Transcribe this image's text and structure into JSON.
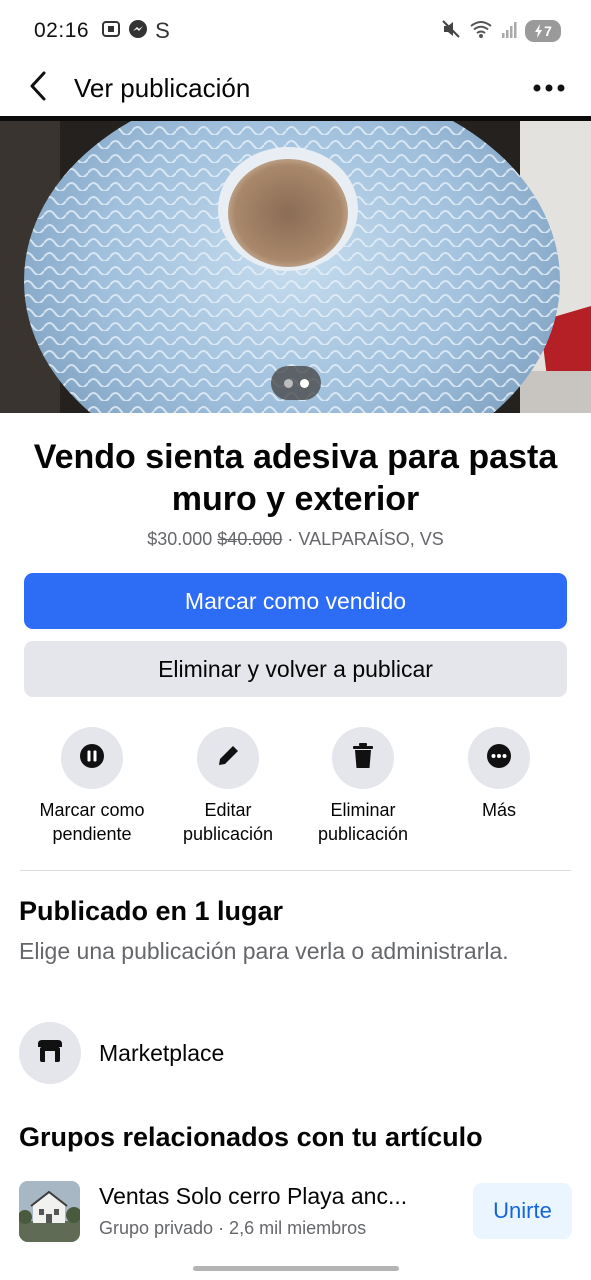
{
  "status_bar": {
    "time": "02:16",
    "left_icons": [
      "screenshot-icon",
      "messenger-icon",
      "s-app-icon"
    ],
    "s_app_glyph": "S",
    "right_icons": [
      "mute-icon",
      "wifi-icon",
      "signal-icon",
      "battery-icon"
    ],
    "battery_level": "7"
  },
  "header": {
    "title": "Ver publicación",
    "back_icon": "chevron-left-icon",
    "menu_icon": "more-horizontal-icon"
  },
  "photo": {
    "pages": 2,
    "active_page": 2
  },
  "listing": {
    "title": "Vendo sienta adesiva para pasta muro y exterior",
    "price": "$30.000",
    "old_price": "$40.000",
    "separator": "·",
    "location": "VALPARAÍSO, VS"
  },
  "buttons": {
    "mark_sold": "Marcar como vendido",
    "delete_repost": "Eliminar y volver a publicar"
  },
  "actions": [
    {
      "icon": "pause-icon",
      "label_line1": "Marcar como",
      "label_line2": "pendiente"
    },
    {
      "icon": "pencil-icon",
      "label_line1": "Editar",
      "label_line2": "publicación"
    },
    {
      "icon": "trash-icon",
      "label_line1": "Eliminar",
      "label_line2": "publicación"
    },
    {
      "icon": "more-icon",
      "label_line1": "Más",
      "label_line2": ""
    }
  ],
  "published": {
    "title": "Publicado en 1 lugar",
    "subtitle": "Elige una publicación para verla o administrarla.",
    "places": [
      {
        "icon": "storefront-icon",
        "label": "Marketplace"
      }
    ]
  },
  "groups": {
    "title": "Grupos relacionados con tu artículo",
    "items": [
      {
        "name": "Ventas Solo cerro Playa anc...",
        "meta": "Grupo privado · 2,6 mil miembros",
        "join_label": "Unirte"
      }
    ]
  },
  "colors": {
    "primary": "#2d6cf5",
    "secondary_bg": "#e4e6eb",
    "muted_text": "#65676b",
    "join_text": "#1466d6",
    "join_bg": "#ebf5ff"
  }
}
